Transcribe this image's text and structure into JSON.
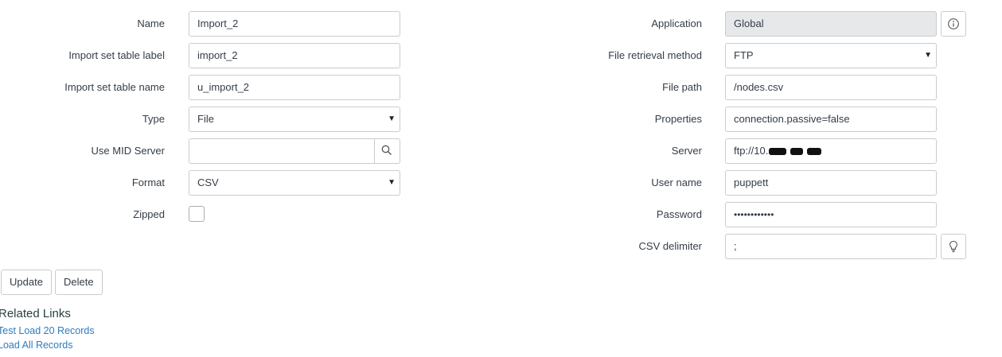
{
  "form": {
    "left": {
      "name": {
        "label": "Name",
        "value": "Import_2"
      },
      "table_label": {
        "label": "Import set table label",
        "value": "import_2"
      },
      "table_name": {
        "label": "Import set table name",
        "value": "u_import_2"
      },
      "type": {
        "label": "Type",
        "value": "File"
      },
      "mid_server": {
        "label": "Use MID Server",
        "value": ""
      },
      "format": {
        "label": "Format",
        "value": "CSV"
      },
      "zipped": {
        "label": "Zipped",
        "checked": false
      }
    },
    "right": {
      "application": {
        "label": "Application",
        "value": "Global"
      },
      "retrieval": {
        "label": "File retrieval method",
        "value": "FTP"
      },
      "file_path": {
        "label": "File path",
        "value": "/nodes.csv"
      },
      "properties": {
        "label": "Properties",
        "value": "connection.passive=false"
      },
      "server": {
        "label": "Server",
        "value_prefix": "ftp://10."
      },
      "user_name": {
        "label": "User name",
        "value": "puppett"
      },
      "password": {
        "label": "Password",
        "value": "••••••••••••"
      },
      "csv_delimiter": {
        "label": "CSV delimiter",
        "value": ";"
      }
    }
  },
  "buttons": {
    "update": "Update",
    "delete": "Delete"
  },
  "related": {
    "title": "Related Links",
    "links": [
      "Test Load 20 Records",
      "Load All Records"
    ]
  },
  "icons": {
    "mid_server_lookup": "search-icon",
    "application_info": "info-icon",
    "delimiter_suggestion": "lightbulb-icon",
    "select_arrow": "caret-down-icon"
  },
  "colors": {
    "link": "#2b7cbf",
    "readonly_bg": "#e6e8ea",
    "border": "#c8ccd0"
  }
}
